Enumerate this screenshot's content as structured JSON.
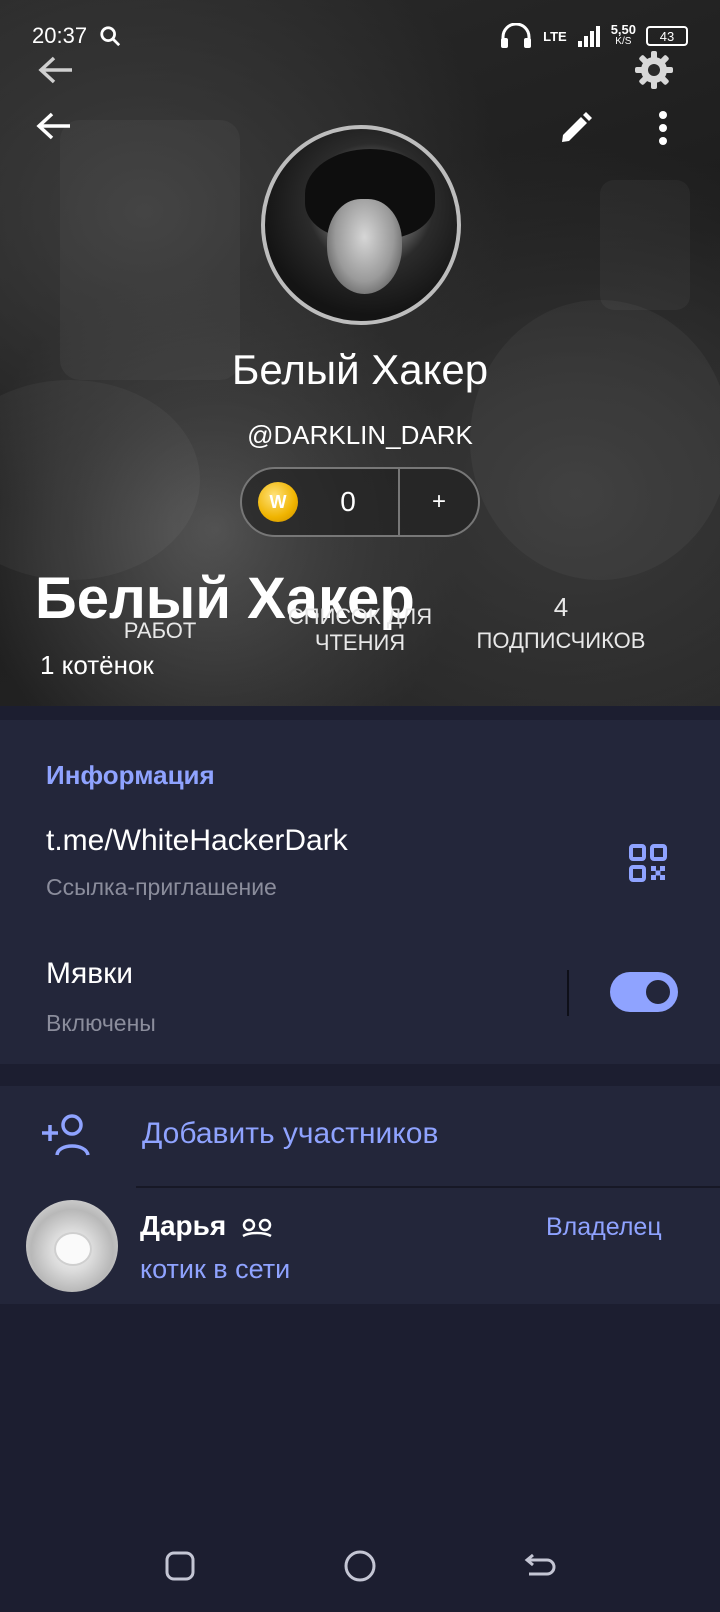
{
  "status_bar": {
    "time": "20:37",
    "network": "LTE",
    "speed": "5,50",
    "speed_unit": "K/S",
    "battery": "43"
  },
  "profile": {
    "name": "Белый Хакер",
    "username": "@DARKLIN_DARK",
    "coins": "0",
    "coin_symbol": "W",
    "add_coins_label": "+",
    "big_title": "Белый Хакер",
    "kitten_count": "1 котёнок"
  },
  "stats": [
    {
      "value": "",
      "label": "РАБОТ"
    },
    {
      "value": "",
      "label": "СПИСОК ДЛЯ ЧТЕНИЯ"
    },
    {
      "value": "4",
      "label": "ПОДПИСЧИКОВ"
    }
  ],
  "info": {
    "title": "Информация",
    "link": "t.me/WhiteHackerDark",
    "link_caption": "Ссылка-приглашение",
    "toggle_label": "Мявки",
    "toggle_caption": "Включены",
    "toggle_on": true
  },
  "members": {
    "add_label": "Добавить участников",
    "list": [
      {
        "name": "Дарья",
        "status": "котик в сети",
        "role": "Владелец"
      }
    ]
  },
  "colors": {
    "accent": "#8fa3ff",
    "section_bg": "#23263a",
    "page_bg": "#1c1e30"
  },
  "icons": [
    "search-icon",
    "back-arrow-icon",
    "gear-icon",
    "edit-pencil-icon",
    "more-vert-icon",
    "qr-code-icon",
    "add-user-icon",
    "recents-nav-icon",
    "home-nav-icon",
    "back-nav-icon"
  ]
}
